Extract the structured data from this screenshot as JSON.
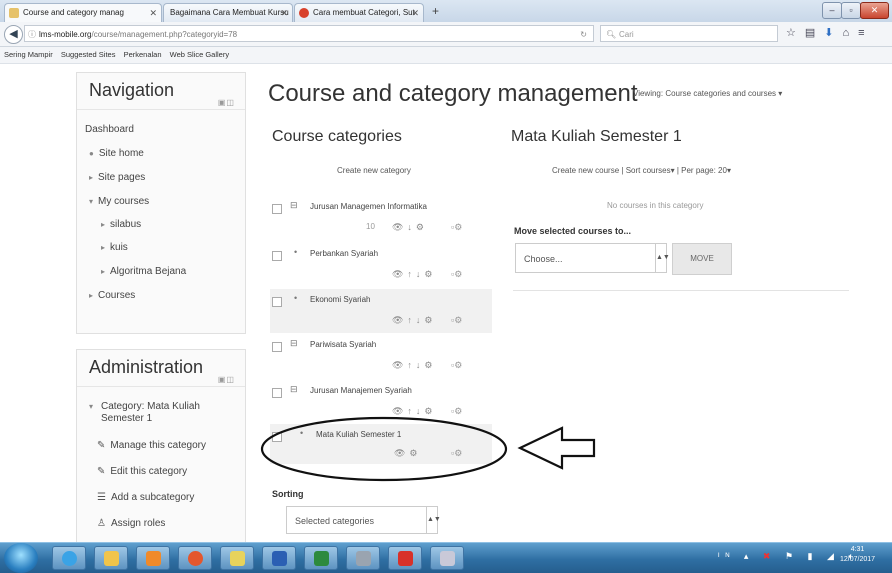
{
  "browser": {
    "tabs": [
      {
        "label": "Course and category manag"
      },
      {
        "label": "Bagaimana Cara Membuat Kursu"
      },
      {
        "label": "Cara membuat Categori, Sut"
      }
    ],
    "new_tab": "+",
    "url_host": "lms-mobile.org",
    "url_path": "/course/management.php?categoryid=78",
    "search_placeholder": "Cari",
    "bookmarks": [
      "Sering Mampir",
      "Suggested Sites",
      "Perkenalan",
      "Web Slice Gallery"
    ]
  },
  "navigation": {
    "title": "Navigation",
    "items": [
      "Dashboard",
      "Site home",
      "Site pages",
      "My courses",
      "silabus",
      "kuis",
      "Algoritma Bejana",
      "Courses"
    ]
  },
  "administration": {
    "title": "Administration",
    "items": [
      "Category: Mata Kuliah Semester 1",
      "Manage this category",
      "Edit this category",
      "Add a subcategory",
      "Assign roles"
    ]
  },
  "main": {
    "title": "Course and category management",
    "viewing": "Viewing: Course categories and courses"
  },
  "categories": {
    "heading": "Course categories",
    "create_link": "Create new category",
    "list": [
      {
        "name": "Jurusan Managemen Informatika",
        "count": "10"
      },
      {
        "name": "Perbankan Syariah"
      },
      {
        "name": "Ekonomi Syariah"
      },
      {
        "name": "Pariwisata Syariah"
      },
      {
        "name": "Jurusan Manajemen Syariah"
      },
      {
        "name": "Mata Kuliah Semester 1"
      }
    ],
    "sorting_label": "Sorting",
    "sorting_value": "Selected categories"
  },
  "courses": {
    "heading": "Mata Kuliah Semester 1",
    "create_link": "Create new course",
    "sort_link": "Sort courses",
    "perpage": "Per page: 20",
    "empty": "No courses in this category",
    "move_label": "Move selected courses to...",
    "choose": "Choose...",
    "move_btn": "MOVE"
  },
  "taskbar": {
    "time": "4:31",
    "date": "12/07/2017"
  }
}
